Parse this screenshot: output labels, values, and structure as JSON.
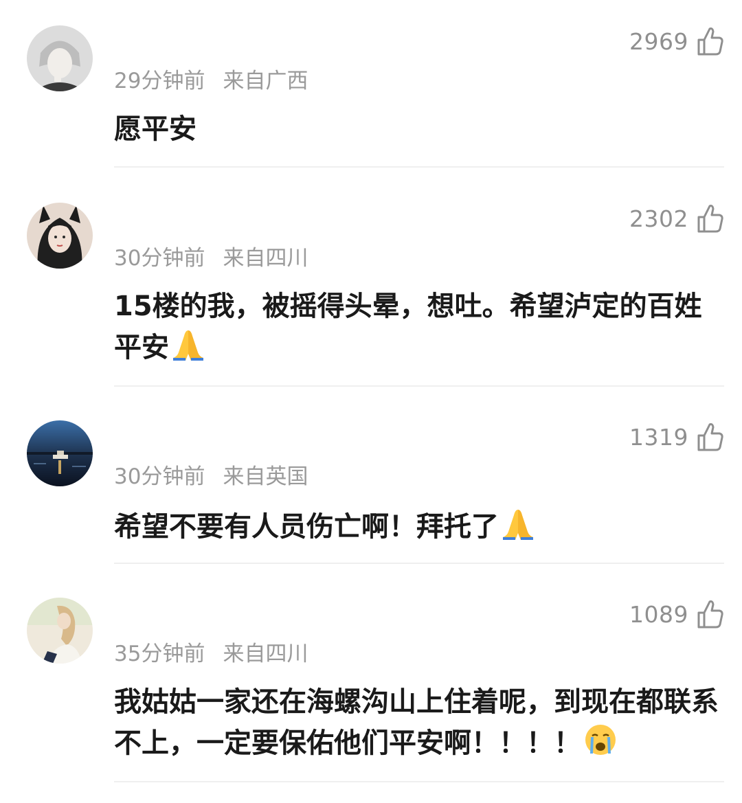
{
  "comments": [
    {
      "likes": "2969",
      "time": "29分钟前",
      "location": "来自广西",
      "text": "愿平安"
    },
    {
      "likes": "2302",
      "time": "30分钟前",
      "location": "来自四川",
      "text": "15楼的我，被摇得头晕，想吐。希望泸定的百姓平安",
      "emoji": "folded-hands"
    },
    {
      "likes": "1319",
      "time": "30分钟前",
      "location": "来自英国",
      "text": "希望不要有人员伤亡啊！拜托了",
      "emoji": "folded-hands"
    },
    {
      "likes": "1089",
      "time": "35分钟前",
      "location": "来自四川",
      "text": "我姑姑一家还在海螺沟山上住着呢，到现在都联系不上，一定要保佑他们平安啊！！！！",
      "emoji": "crying-face"
    }
  ],
  "icons": {
    "like": "thumbs-up-outline-icon"
  },
  "colors": {
    "meta_text": "#9a9a9a",
    "body_text": "#1a1a1a",
    "divider": "#efefef"
  }
}
